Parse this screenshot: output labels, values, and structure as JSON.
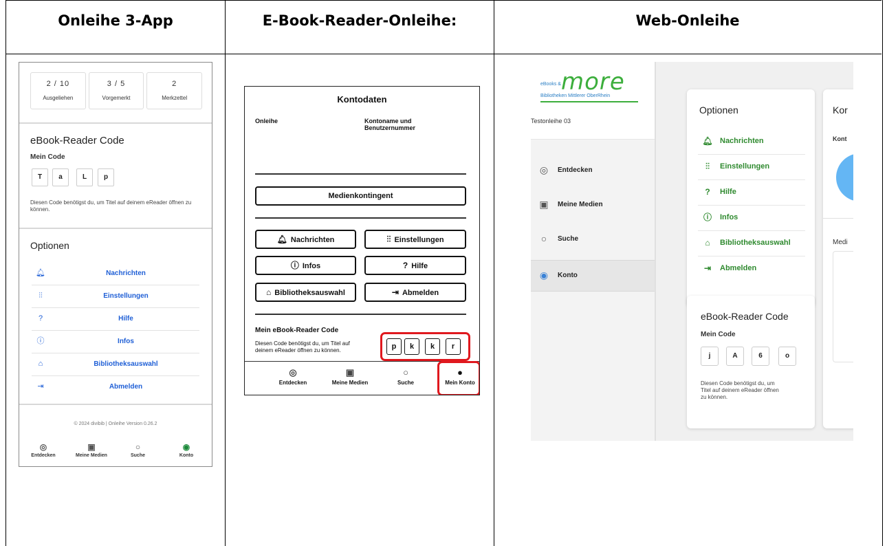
{
  "columns": [
    {
      "title": "Onleihe 3-App"
    },
    {
      "title": "E-Book-Reader-Onleihe:"
    },
    {
      "title": "Web-Onleihe"
    }
  ],
  "app": {
    "stats": [
      {
        "value": "2 / 10",
        "label": "Ausgeliehen"
      },
      {
        "value": "3 / 5",
        "label": "Vorgemerkt"
      },
      {
        "value": "2",
        "label": "Merkzettel"
      }
    ],
    "code_title": "eBook-Reader Code",
    "code_sub": "Mein Code",
    "code": [
      "T",
      "a",
      "L",
      "p"
    ],
    "code_desc": "Diesen Code benötigst du, um Titel auf deinem eReader öffnen zu können.",
    "options_title": "Optionen",
    "options": [
      {
        "icon": "bell-icon",
        "glyph": "🔔",
        "label": "Nachrichten"
      },
      {
        "icon": "sliders-icon",
        "glyph": "⫶",
        "label": "Einstellungen"
      },
      {
        "icon": "help-icon",
        "glyph": "?",
        "label": "Hilfe"
      },
      {
        "icon": "info-icon",
        "glyph": "ⓘ",
        "label": "Infos"
      },
      {
        "icon": "library-icon",
        "glyph": "⌂",
        "label": "Bibliotheksauswahl"
      },
      {
        "icon": "logout-icon",
        "glyph": "⇥",
        "label": "Abmelden"
      }
    ],
    "footer": "© 2024 divibib | Onleihe Version 0.26.2",
    "nav": [
      {
        "label": "Entdecken"
      },
      {
        "label": "Meine Medien"
      },
      {
        "label": "Suche"
      },
      {
        "label": "Konto"
      }
    ]
  },
  "ereader": {
    "title": "Kontodaten",
    "left_label": "Onleihe",
    "right_label_1": "Kontoname und",
    "right_label_2": "Benutzernummer",
    "media_button": "Medienkontingent",
    "buttons": [
      {
        "label": "Nachrichten"
      },
      {
        "label": "Einstellungen"
      },
      {
        "label": "Infos"
      },
      {
        "label": "Hilfe"
      },
      {
        "label": "Bibliotheksauswahl"
      },
      {
        "label": "Abmelden"
      }
    ],
    "code_title": "Mein eBook-Reader Code",
    "code_desc_1": "Diesen Code benötigst du, um Titel auf",
    "code_desc_2": "deinem eReader öffnen zu können.",
    "code": [
      "p",
      "k",
      "k",
      "r"
    ],
    "nav": [
      {
        "label": "Entdecken"
      },
      {
        "label": "Meine Medien"
      },
      {
        "label": "Suche"
      },
      {
        "label": "Mein Konto"
      }
    ],
    "highlight_color": "#e0181e"
  },
  "web": {
    "logo_small": "eBooks &",
    "logo_more": "more",
    "logo_bib": "Bibliotheken Mittlerer OberRhein",
    "user": "Testonleihe 03",
    "nav": [
      {
        "label": "Entdecken"
      },
      {
        "label": "Meine Medien"
      },
      {
        "label": "Suche"
      },
      {
        "label": "Konto"
      }
    ],
    "options_title": "Optionen",
    "options": [
      {
        "label": "Nachrichten"
      },
      {
        "label": "Einstellungen"
      },
      {
        "label": "Hilfe"
      },
      {
        "label": "Infos"
      },
      {
        "label": "Bibliotheksauswahl"
      },
      {
        "label": "Abmelden"
      }
    ],
    "code_title": "eBook-Reader Code",
    "code_sub": "Mein Code",
    "code": [
      "j",
      "A",
      "6",
      "o"
    ],
    "code_desc_1": "Diesen Code benötigst du, um",
    "code_desc_2": "Titel auf deinem eReader öffnen",
    "code_desc_3": "zu können.",
    "right_card_title": "Kor",
    "right_card_sub": "Kont",
    "right_card_medi": "Medi",
    "accent_green": "#2f8a2f",
    "accent_blue": "#64b6f4"
  }
}
